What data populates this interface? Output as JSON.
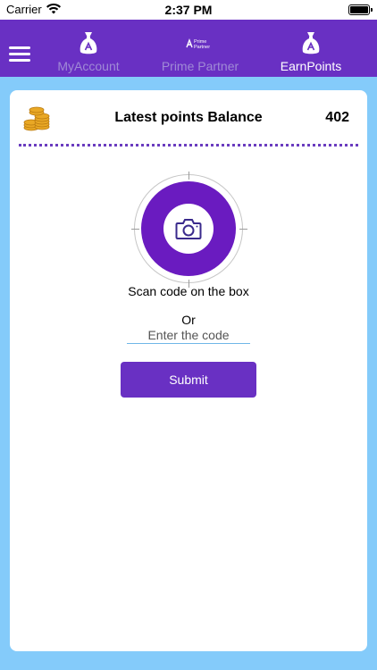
{
  "status_bar": {
    "carrier": "Carrier",
    "time": "2:37 PM"
  },
  "nav": {
    "tabs": [
      {
        "label": "MyAccount",
        "icon": "money-bag-icon"
      },
      {
        "label": "Prime Partner",
        "icon": "prime-partner-logo"
      },
      {
        "label": "EarnPoints",
        "icon": "money-bag-icon"
      }
    ],
    "active_tab": "EarnPoints",
    "prime_logo_text": [
      "Prime",
      "Partner"
    ]
  },
  "balance": {
    "label": "Latest points Balance",
    "value": "402"
  },
  "scan": {
    "label": "Scan code on the box",
    "or_label": "Or"
  },
  "code_input": {
    "value": "",
    "placeholder": "Enter the code"
  },
  "submit": {
    "label": "Submit"
  },
  "colors": {
    "primary": "#6930c3",
    "scanner_fill": "#6a1bc0",
    "background": "#84cbfa",
    "inactive_tab": "#a08ad6",
    "active_tab": "#ffffff",
    "coin": "#e9a825"
  }
}
